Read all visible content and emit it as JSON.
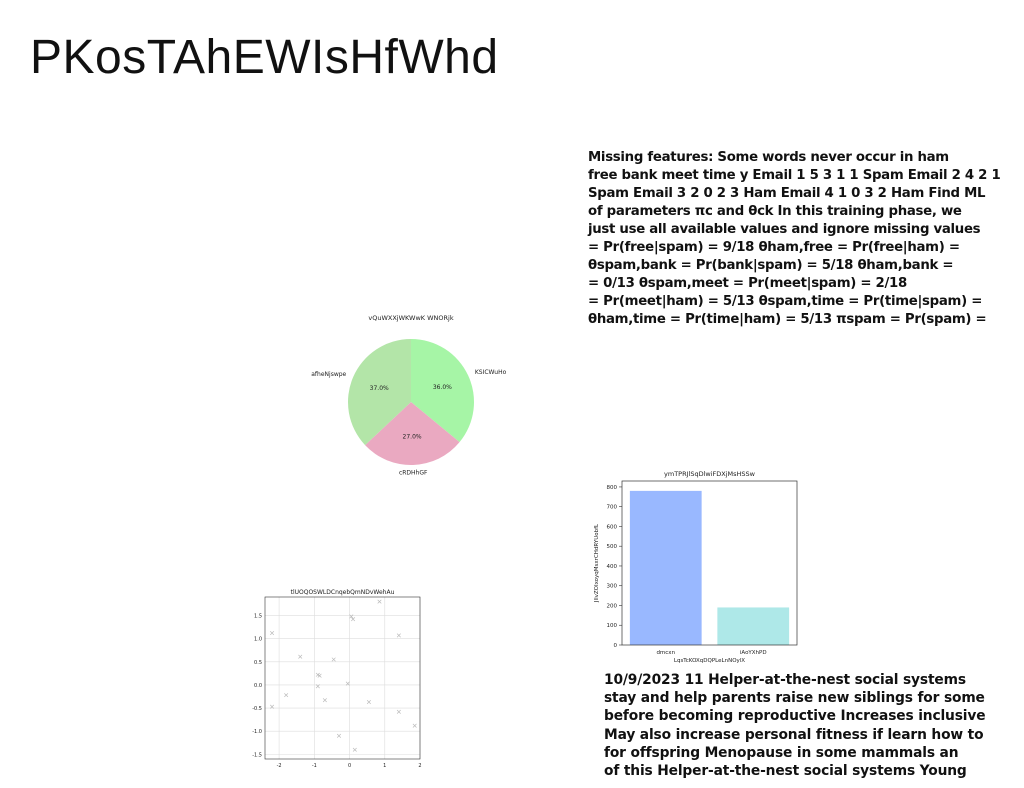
{
  "slide": {
    "title": "PKosTAhEWIsHfWhd",
    "text_block_1": "Missing features: Some words never occur in ham\nfree bank meet time y Email 1 5 3 1 1 Spam Email 2 4 2 1\nSpam Email 3 2 0 2 3 Ham Email 4 1 0 3 2 Ham Find ML\nof parameters πc and θck In this training phase, we\njust use all available values and ignore missing values\n= Pr(free|spam) = 9/18 θham,free = Pr(free|ham) =\nθspam,bank = Pr(bank|spam) = 5/18 θham,bank =\n= 0/13 θspam,meet = Pr(meet|spam) = 2/18\n= Pr(meet|ham) = 5/13 θspam,time = Pr(time|spam) =\nθham,time = Pr(time|ham) = 5/13 πspam = Pr(spam) =",
    "text_block_2": "10/9/2023 11 Helper-at-the-nest social systems\nstay and help parents raise new siblings for some\nbefore becoming reproductive Increases inclusive\nMay also increase personal fitness if learn how to\nfor offspring Menopause in some mammals an\nof this Helper-at-the-nest social systems Young"
  },
  "chart_data": [
    {
      "type": "pie",
      "title": "vQuWXXjWKWwK WNORjk",
      "labels": [
        "KSICWuHo",
        "cRDHhGF",
        "afheNjswpe"
      ],
      "values": [
        36.0,
        27.0,
        37.0
      ],
      "value_labels": [
        "36.0%",
        "27.0%",
        "37.0%"
      ],
      "colors": [
        "#a6f5a6",
        "#eaa9c1",
        "#b3e5a8"
      ],
      "start_angle_deg": 90,
      "direction": "clockwise"
    },
    {
      "type": "bar",
      "title": "ymTPRJlSqDlwiFDXjMsHSSw",
      "xlabel": "LqsTcKOXqDQPLeLnNOylX",
      "ylabel": "JllvZOIxoyqMsxrCHdRYUobfL",
      "categories": [
        "dmcxn",
        "iAoYXhPD"
      ],
      "values": [
        780,
        190
      ],
      "colors": [
        "#99b8ff",
        "#aee8e8"
      ],
      "ylim": [
        0,
        830
      ],
      "yticks": [
        0,
        100,
        200,
        300,
        400,
        500,
        600,
        700,
        800
      ]
    },
    {
      "type": "scatter",
      "title": "tlUOQOSWLDCnqebQmNDvWehAu",
      "marker": "x",
      "marker_color": "#bbbbbb",
      "grid": true,
      "xlim": [
        -2.4,
        2.0
      ],
      "ylim": [
        -1.6,
        1.9
      ],
      "xticks": [
        -2,
        -1,
        0,
        1,
        2
      ],
      "yticks": [
        -1.5,
        -1.0,
        -0.5,
        0.0,
        0.5,
        1.0,
        1.5
      ],
      "points": [
        {
          "x": -2.2,
          "y": 1.12
        },
        {
          "x": -1.4,
          "y": 0.61
        },
        {
          "x": -0.9,
          "y": 0.22
        },
        {
          "x": -0.85,
          "y": 0.2
        },
        {
          "x": -0.45,
          "y": 0.55
        },
        {
          "x": 0.05,
          "y": 1.48
        },
        {
          "x": 0.1,
          "y": 1.42
        },
        {
          "x": 0.85,
          "y": 1.8
        },
        {
          "x": 1.4,
          "y": 1.07
        },
        {
          "x": -1.8,
          "y": -0.22
        },
        {
          "x": -2.2,
          "y": -0.47
        },
        {
          "x": -0.9,
          "y": -0.03
        },
        {
          "x": -0.7,
          "y": -0.33
        },
        {
          "x": -0.05,
          "y": 0.03
        },
        {
          "x": 0.55,
          "y": -0.37
        },
        {
          "x": -0.3,
          "y": -1.1
        },
        {
          "x": 0.15,
          "y": -1.4
        },
        {
          "x": 1.4,
          "y": -0.58
        },
        {
          "x": 1.85,
          "y": -0.88
        }
      ]
    }
  ]
}
